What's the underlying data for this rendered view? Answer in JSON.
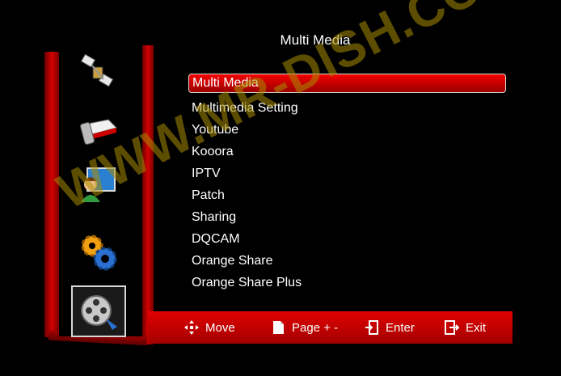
{
  "title": "Multi Media",
  "menu": {
    "items": [
      {
        "label": "Multi Media",
        "selected": true
      },
      {
        "label": "Multimedia Setting"
      },
      {
        "label": "Youtube"
      },
      {
        "label": "Kooora"
      },
      {
        "label": "IPTV"
      },
      {
        "label": "Patch"
      },
      {
        "label": "Sharing"
      },
      {
        "label": "DQCAM"
      },
      {
        "label": "Orange Share"
      },
      {
        "label": "Orange Share Plus"
      }
    ]
  },
  "sidebar": {
    "icons": [
      {
        "name": "satellite-icon"
      },
      {
        "name": "tv-receiver-icon"
      },
      {
        "name": "user-monitor-icon"
      },
      {
        "name": "gears-icon"
      },
      {
        "name": "film-reel-icon",
        "active": true
      }
    ]
  },
  "footer": {
    "move": "Move",
    "page": "Page + -",
    "enter": "Enter",
    "exit": "Exit"
  },
  "watermark": "WWW.MR-DISH.COM",
  "colors": {
    "accent": "#d40000",
    "background": "#000000",
    "watermark": "#aa8c00"
  }
}
